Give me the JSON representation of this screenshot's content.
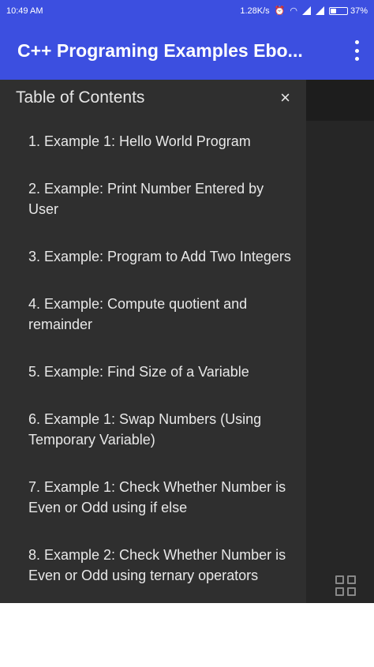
{
  "status_bar": {
    "time": "10:49 AM",
    "network_speed": "1.28K/s",
    "battery": "37%",
    "battery_level": 0.37
  },
  "app_bar": {
    "title": "C++ Programing Examples Ebo..."
  },
  "drawer": {
    "title": "Table of Contents",
    "close_label": "×",
    "items": [
      {
        "label": "1. Example 1: Hello World Program"
      },
      {
        "label": "2. Example: Print Number Entered by User"
      },
      {
        "label": "3. Example: Program to Add Two Integers"
      },
      {
        "label": "4. Example: Compute quotient and remainder"
      },
      {
        "label": "5. Example: Find Size of a Variable"
      },
      {
        "label": "6. Example 1: Swap Numbers (Using Temporary Variable)"
      },
      {
        "label": "7. Example 1: Check Whether Number is Even or Odd using if else"
      },
      {
        "label": "8. Example 2: Check Whether Number is Even or Odd using ternary operators"
      }
    ]
  },
  "colors": {
    "primary": "#3c4fe0",
    "drawer_bg": "#2f2f2f"
  }
}
